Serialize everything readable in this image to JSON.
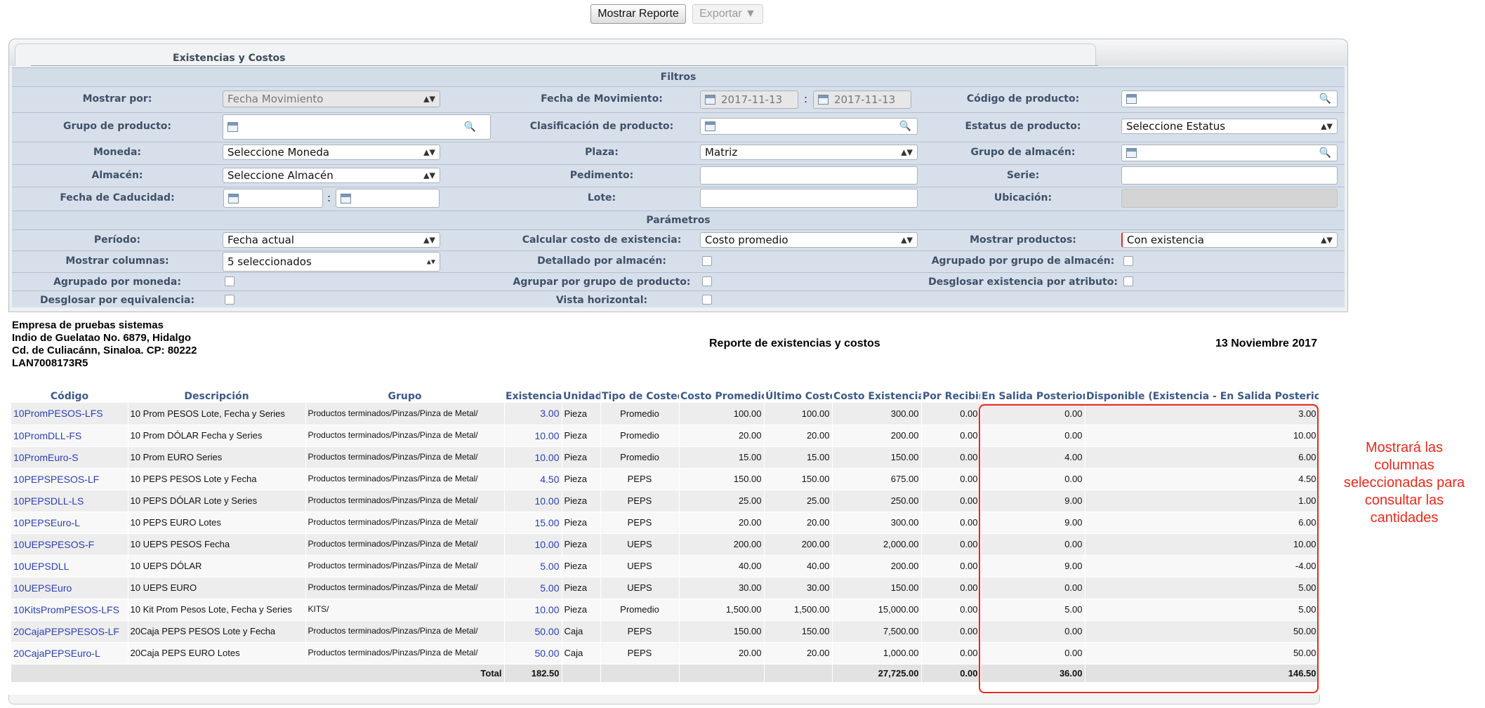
{
  "toolbar": {
    "report_label": "Mostrar Reporte",
    "export_label": "Exportar ▼"
  },
  "tab": {
    "label": "Existencias y Costos"
  },
  "filters": {
    "title": "Filtros",
    "mostrar_por": {
      "label": "Mostrar por:",
      "value": "Fecha Movimiento"
    },
    "fecha_mov": {
      "label": "Fecha de Movimiento:",
      "from": "2017-11-13",
      "to": "2017-11-13"
    },
    "codigo": {
      "label": "Código de producto:",
      "value": ""
    },
    "grupo": {
      "label": "Grupo de producto:",
      "value": ""
    },
    "clasificacion": {
      "label": "Clasificación de producto:",
      "value": ""
    },
    "estatus": {
      "label": "Estatus de producto:",
      "value": "Seleccione Estatus"
    },
    "moneda": {
      "label": "Moneda:",
      "value": "Seleccione Moneda"
    },
    "plaza": {
      "label": "Plaza:",
      "value": "Matriz"
    },
    "grupo_almacen": {
      "label": "Grupo de almacén:",
      "value": ""
    },
    "almacen": {
      "label": "Almacén:",
      "value": "Seleccione Almacén"
    },
    "pedimento": {
      "label": "Pedimento:",
      "value": ""
    },
    "serie": {
      "label": "Serie:",
      "value": ""
    },
    "caducidad": {
      "label": "Fecha de Caducidad:",
      "from": "",
      "to": ""
    },
    "lote": {
      "label": "Lote:",
      "value": ""
    },
    "ubicacion": {
      "label": "Ubicación:",
      "value": ""
    }
  },
  "params": {
    "title": "Parámetros",
    "periodo": {
      "label": "Período:",
      "value": "Fecha actual"
    },
    "calcular": {
      "label": "Calcular costo de existencia:",
      "value": "Costo promedio"
    },
    "mostrar_productos": {
      "label": "Mostrar productos:",
      "value": "Con existencia"
    },
    "mostrar_columnas": {
      "label": "Mostrar columnas:",
      "value": "5 seleccionados"
    },
    "detallado": {
      "label": "Detallado por almacén:"
    },
    "agrupado_grupo_almacen": {
      "label": "Agrupado por grupo de almacén:"
    },
    "agrupado_moneda": {
      "label": "Agrupado por moneda:"
    },
    "agrupar_grupo_producto": {
      "label": "Agrupar por grupo de producto:"
    },
    "desglosar_atributo": {
      "label": "Desglosar existencia por atributo:"
    },
    "desglosar_equivalencia": {
      "label": "Desglosar por equivalencia:"
    },
    "vista_horizontal": {
      "label": "Vista horizontal:"
    }
  },
  "company": {
    "name": "Empresa de pruebas sistemas",
    "address1": "Indio de Guelatao No. 6879, Hidalgo",
    "address2": "Cd. de Culiacánn, Sinaloa. CP: 80222",
    "rfc": "LAN7008173R5"
  },
  "report": {
    "title": "Reporte de existencias y costos",
    "date": "13 Noviembre 2017"
  },
  "table": {
    "headers": [
      "Código",
      "Descripción",
      "Grupo",
      "Existencia",
      "Unidad",
      "Tipo de Costeo",
      "Costo Promedio",
      "Último Costo",
      "Costo Existencia",
      "Por Recibir",
      "En Salida Posterior",
      "Disponible (Existencia - En Salida Posterior)"
    ],
    "rows": [
      [
        "10PromPESOS-LFS",
        "10 Prom PESOS Lote, Fecha y Series",
        "Productos terminados/Pinzas/Pinza de Metal/",
        "3.00",
        "Pieza",
        "Promedio",
        "100.00",
        "100.00",
        "300.00",
        "0.00",
        "0.00",
        "3.00"
      ],
      [
        "10PromDLL-FS",
        "10 Prom DÓLAR Fecha y Series",
        "Productos terminados/Pinzas/Pinza de Metal/",
        "10.00",
        "Pieza",
        "Promedio",
        "20.00",
        "20.00",
        "200.00",
        "0.00",
        "0.00",
        "10.00"
      ],
      [
        "10PromEuro-S",
        "10 Prom EURO Series",
        "Productos terminados/Pinzas/Pinza de Metal/",
        "10.00",
        "Pieza",
        "Promedio",
        "15.00",
        "15.00",
        "150.00",
        "0.00",
        "4.00",
        "6.00"
      ],
      [
        "10PEPSPESOS-LF",
        "10 PEPS PESOS Lote y Fecha",
        "Productos terminados/Pinzas/Pinza de Metal/",
        "4.50",
        "Pieza",
        "PEPS",
        "150.00",
        "150.00",
        "675.00",
        "0.00",
        "0.00",
        "4.50"
      ],
      [
        "10PEPSDLL-LS",
        "10 PEPS DÓLAR Lote y Series",
        "Productos terminados/Pinzas/Pinza de Metal/",
        "10.00",
        "Pieza",
        "PEPS",
        "25.00",
        "25.00",
        "250.00",
        "0.00",
        "9.00",
        "1.00"
      ],
      [
        "10PEPSEuro-L",
        "10 PEPS EURO Lotes",
        "Productos terminados/Pinzas/Pinza de Metal/",
        "15.00",
        "Pieza",
        "PEPS",
        "20.00",
        "20.00",
        "300.00",
        "0.00",
        "9.00",
        "6.00"
      ],
      [
        "10UEPSPESOS-F",
        "10 UEPS PESOS Fecha",
        "Productos terminados/Pinzas/Pinza de Metal/",
        "10.00",
        "Pieza",
        "UEPS",
        "200.00",
        "200.00",
        "2,000.00",
        "0.00",
        "0.00",
        "10.00"
      ],
      [
        "10UEPSDLL",
        "10 UEPS DÓLAR",
        "Productos terminados/Pinzas/Pinza de Metal/",
        "5.00",
        "Pieza",
        "UEPS",
        "40.00",
        "40.00",
        "200.00",
        "0.00",
        "9.00",
        "-4.00"
      ],
      [
        "10UEPSEuro",
        "10 UEPS EURO",
        "Productos terminados/Pinzas/Pinza de Metal/",
        "5.00",
        "Pieza",
        "UEPS",
        "30.00",
        "30.00",
        "150.00",
        "0.00",
        "0.00",
        "5.00"
      ],
      [
        "10KitsPromPESOS-LFS",
        "10 Kit Prom Pesos Lote, Fecha y Series",
        "KITS/",
        "10.00",
        "Pieza",
        "Promedio",
        "1,500.00",
        "1,500.00",
        "15,000.00",
        "0.00",
        "5.00",
        "5.00"
      ],
      [
        "20CajaPEPSPESOS-LF",
        "20Caja PEPS PESOS Lote y Fecha",
        "Productos terminados/Pinzas/Pinza de Metal/",
        "50.00",
        "Caja",
        "PEPS",
        "150.00",
        "150.00",
        "7,500.00",
        "0.00",
        "0.00",
        "50.00"
      ],
      [
        "20CajaPEPSEuro-L",
        "20Caja PEPS EURO Lotes",
        "Productos terminados/Pinzas/Pinza de Metal/",
        "50.00",
        "Caja",
        "PEPS",
        "20.00",
        "20.00",
        "1,000.00",
        "0.00",
        "0.00",
        "50.00"
      ]
    ],
    "total": {
      "label": "Total",
      "existencia": "182.50",
      "costo_existencia": "27,725.00",
      "por_recibir": "0.00",
      "en_salida": "36.00",
      "disponible": "146.50"
    }
  },
  "annotation": "Mostrará las columnas seleccionadas para consultar las cantidades",
  "colors": {
    "link": "#2b3fb0",
    "label": "#3f5068",
    "highlight": "#e8291c"
  }
}
